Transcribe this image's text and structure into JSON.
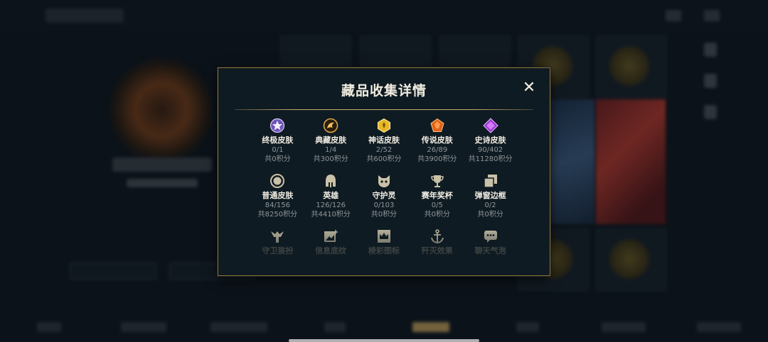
{
  "dialog": {
    "title": "藏品收集详情",
    "close_glyph": "✕"
  },
  "categories": [
    {
      "name": "终极皮肤",
      "count": "0/1",
      "points": "共0积分",
      "icon": "ultimate-gem-icon",
      "color": "#b79cf0"
    },
    {
      "name": "典藏皮肤",
      "count": "1/4",
      "points": "共300积分",
      "icon": "prestige-emblem-icon",
      "color": "#d9a34a"
    },
    {
      "name": "神话皮肤",
      "count": "2/52",
      "points": "共600积分",
      "icon": "mythic-gem-icon",
      "color": "#e7b72a"
    },
    {
      "name": "传说皮肤",
      "count": "26/89",
      "points": "共3900积分",
      "icon": "legendary-gem-icon",
      "color": "#f07a22"
    },
    {
      "name": "史诗皮肤",
      "count": "90/402",
      "points": "共11280积分",
      "icon": "epic-gem-icon",
      "color": "#b34bdf"
    },
    {
      "name": "普通皮肤",
      "count": "84/156",
      "points": "共8250积分",
      "icon": "standard-ring-icon",
      "color": "#c9c1a8"
    },
    {
      "name": "英雄",
      "count": "126/126",
      "points": "共4410积分",
      "icon": "helmet-icon",
      "color": "#c9c1a8"
    },
    {
      "name": "守护灵",
      "count": "0/103",
      "points": "共0积分",
      "icon": "little-legend-icon",
      "color": "#c9c1a8"
    },
    {
      "name": "赛年奖杯",
      "count": "0/5",
      "points": "共0积分",
      "icon": "trophy-icon",
      "color": "#c9c1a8"
    },
    {
      "name": "弹窗边框",
      "count": "0/2",
      "points": "共0积分",
      "icon": "frame-icon",
      "color": "#c9c1a8"
    },
    {
      "name": "守卫装扮",
      "icon": "ward-icon",
      "color": "#c9c1a8"
    },
    {
      "name": "信息底纹",
      "icon": "banner-icon",
      "color": "#c9c1a8"
    },
    {
      "name": "棱彩图标",
      "icon": "crown-icon",
      "color": "#c9c1a8"
    },
    {
      "name": "歼灭效果",
      "icon": "anchor-icon",
      "color": "#c9c1a8"
    },
    {
      "name": "聊天气泡",
      "icon": "chat-bubble-icon",
      "color": "#c9c1a8"
    }
  ],
  "colors": {
    "accent_gold": "#c8aa6e",
    "panel_bg": "#0f1b22",
    "page_bg": "#0b1219"
  }
}
